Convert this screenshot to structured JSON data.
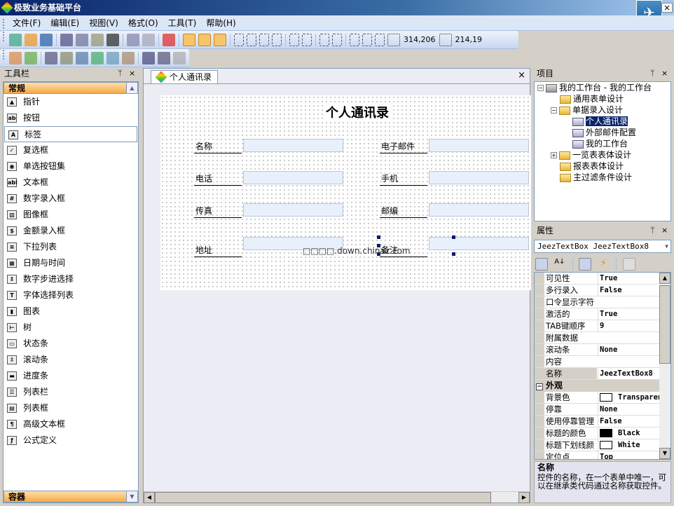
{
  "app": {
    "title": "极致业务基础平台"
  },
  "menu": [
    "文件(F)",
    "编辑(E)",
    "视图(V)",
    "格式(O)",
    "工具(T)",
    "帮助(H)"
  ],
  "toolbar1": {
    "group1": [
      "new-icon",
      "open-icon",
      "save-icon",
      "cut-icon",
      "copy-icon",
      "paste-icon",
      "delete-icon",
      "undo-icon",
      "redo-icon",
      "stop-icon"
    ],
    "group2": [
      "grid-toggle-icon",
      "tools-toggle-icon",
      "properties-toggle-icon"
    ],
    "group3": [
      "align-left-icon",
      "align-center-icon",
      "align-right-icon",
      "align-top-icon",
      "align-middle-icon",
      "align-bottom-icon",
      "space-horizontal-icon",
      "space-vertical-icon",
      "same-width-icon",
      "same-height-icon",
      "same-size-icon"
    ],
    "location_icon": "position-icon",
    "location": "314,206",
    "size_icon": "size-icon",
    "size": "214,19"
  },
  "toolbar2": [
    "form-icon",
    "users-icon",
    "hierarchy-icon",
    "settings-icon",
    "formula-icon",
    "export-icon",
    "window-icon",
    "tools-icon",
    "copy-form-icon",
    "list-icon",
    "table-icon"
  ],
  "toolbox": {
    "title": "工具栏",
    "pin": "ᛘ",
    "close": "×",
    "category": "常规",
    "bottom_category": "容器",
    "items": [
      {
        "label": "指针",
        "icon": "▲"
      },
      {
        "label": "按钮",
        "icon": "ab"
      },
      {
        "label": "标签",
        "icon": "A"
      },
      {
        "label": "复选框",
        "icon": "✓"
      },
      {
        "label": "单选按钮集",
        "icon": "◉"
      },
      {
        "label": "文本框",
        "icon": "abl"
      },
      {
        "label": "数字录入框",
        "icon": "#"
      },
      {
        "label": "图像框",
        "icon": "▧"
      },
      {
        "label": "金额录入框",
        "icon": "$"
      },
      {
        "label": "下拉列表",
        "icon": "≡"
      },
      {
        "label": "日期与时间",
        "icon": "▦"
      },
      {
        "label": "数字步进选择",
        "icon": "⇕"
      },
      {
        "label": "字体选择列表",
        "icon": "T"
      },
      {
        "label": "图表",
        "icon": "▮"
      },
      {
        "label": "树",
        "icon": "⊢"
      },
      {
        "label": "状态条",
        "icon": "▭"
      },
      {
        "label": "滚动条",
        "icon": "⇳"
      },
      {
        "label": "进度条",
        "icon": "▬"
      },
      {
        "label": "列表栏",
        "icon": "☰"
      },
      {
        "label": "列表框",
        "icon": "▤"
      },
      {
        "label": "高级文本框",
        "icon": "¶"
      },
      {
        "label": "公式定义",
        "icon": "ƒ"
      }
    ],
    "selected_index": 2
  },
  "document": {
    "tab": "个人通讯录",
    "close": "×",
    "form_title": "个人通讯录",
    "fields_left": [
      "名称",
      "电话",
      "传真",
      "地址"
    ],
    "fields_right": [
      "电子邮件",
      "手机",
      "邮编",
      "备注"
    ],
    "watermark": "□□□□.down.chinaz.com"
  },
  "project": {
    "title": "项目",
    "root": "我的工作台 - 我的工作台",
    "nodes": [
      {
        "label": "通用表单设计",
        "level": 1,
        "type": "folder"
      },
      {
        "label": "单据录入设计",
        "level": 1,
        "type": "folder",
        "expanded": true
      },
      {
        "label": "个人通讯录",
        "level": 2,
        "type": "form",
        "selected": true
      },
      {
        "label": "外部邮件配置",
        "level": 2,
        "type": "form"
      },
      {
        "label": "我的工作台",
        "level": 2,
        "type": "form"
      },
      {
        "label": "一览表表体设计",
        "level": 1,
        "type": "folder",
        "collapsed": true
      },
      {
        "label": "报表表体设计",
        "level": 1,
        "type": "folder"
      },
      {
        "label": "主过滤条件设计",
        "level": 1,
        "type": "folder"
      }
    ]
  },
  "properties": {
    "title": "属性",
    "object": "JeezTextBox JeezTextBox8",
    "rows": [
      {
        "label": "可见性",
        "value": "True"
      },
      {
        "label": "多行录入",
        "value": "False"
      },
      {
        "label": "口令显示字符",
        "value": ""
      },
      {
        "label": "激活的",
        "value": "True"
      },
      {
        "label": "TAB键顺序",
        "value": "9"
      },
      {
        "label": "附属数据",
        "value": ""
      },
      {
        "label": "滚动条",
        "value": "None"
      },
      {
        "label": "内容",
        "value": ""
      },
      {
        "label": "名称",
        "value": "JeezTextBox8",
        "selected": true
      },
      {
        "group": "外观"
      },
      {
        "label": "背景色",
        "value": "Transparent",
        "swatch": "#ffffff"
      },
      {
        "label": "停靠",
        "value": "None"
      },
      {
        "label": "使用停靠管理",
        "value": "False"
      },
      {
        "label": "标题的颜色",
        "value": "Black",
        "swatch": "#000000"
      },
      {
        "label": "标题下划线颜",
        "value": "White",
        "swatch": "#ffffff"
      },
      {
        "label": "定位点",
        "value": "Top"
      }
    ],
    "desc_title": "名称",
    "desc_text": "控件的名称，在一个表单中唯一，可以在继承类代码通过名称获取控件。"
  }
}
